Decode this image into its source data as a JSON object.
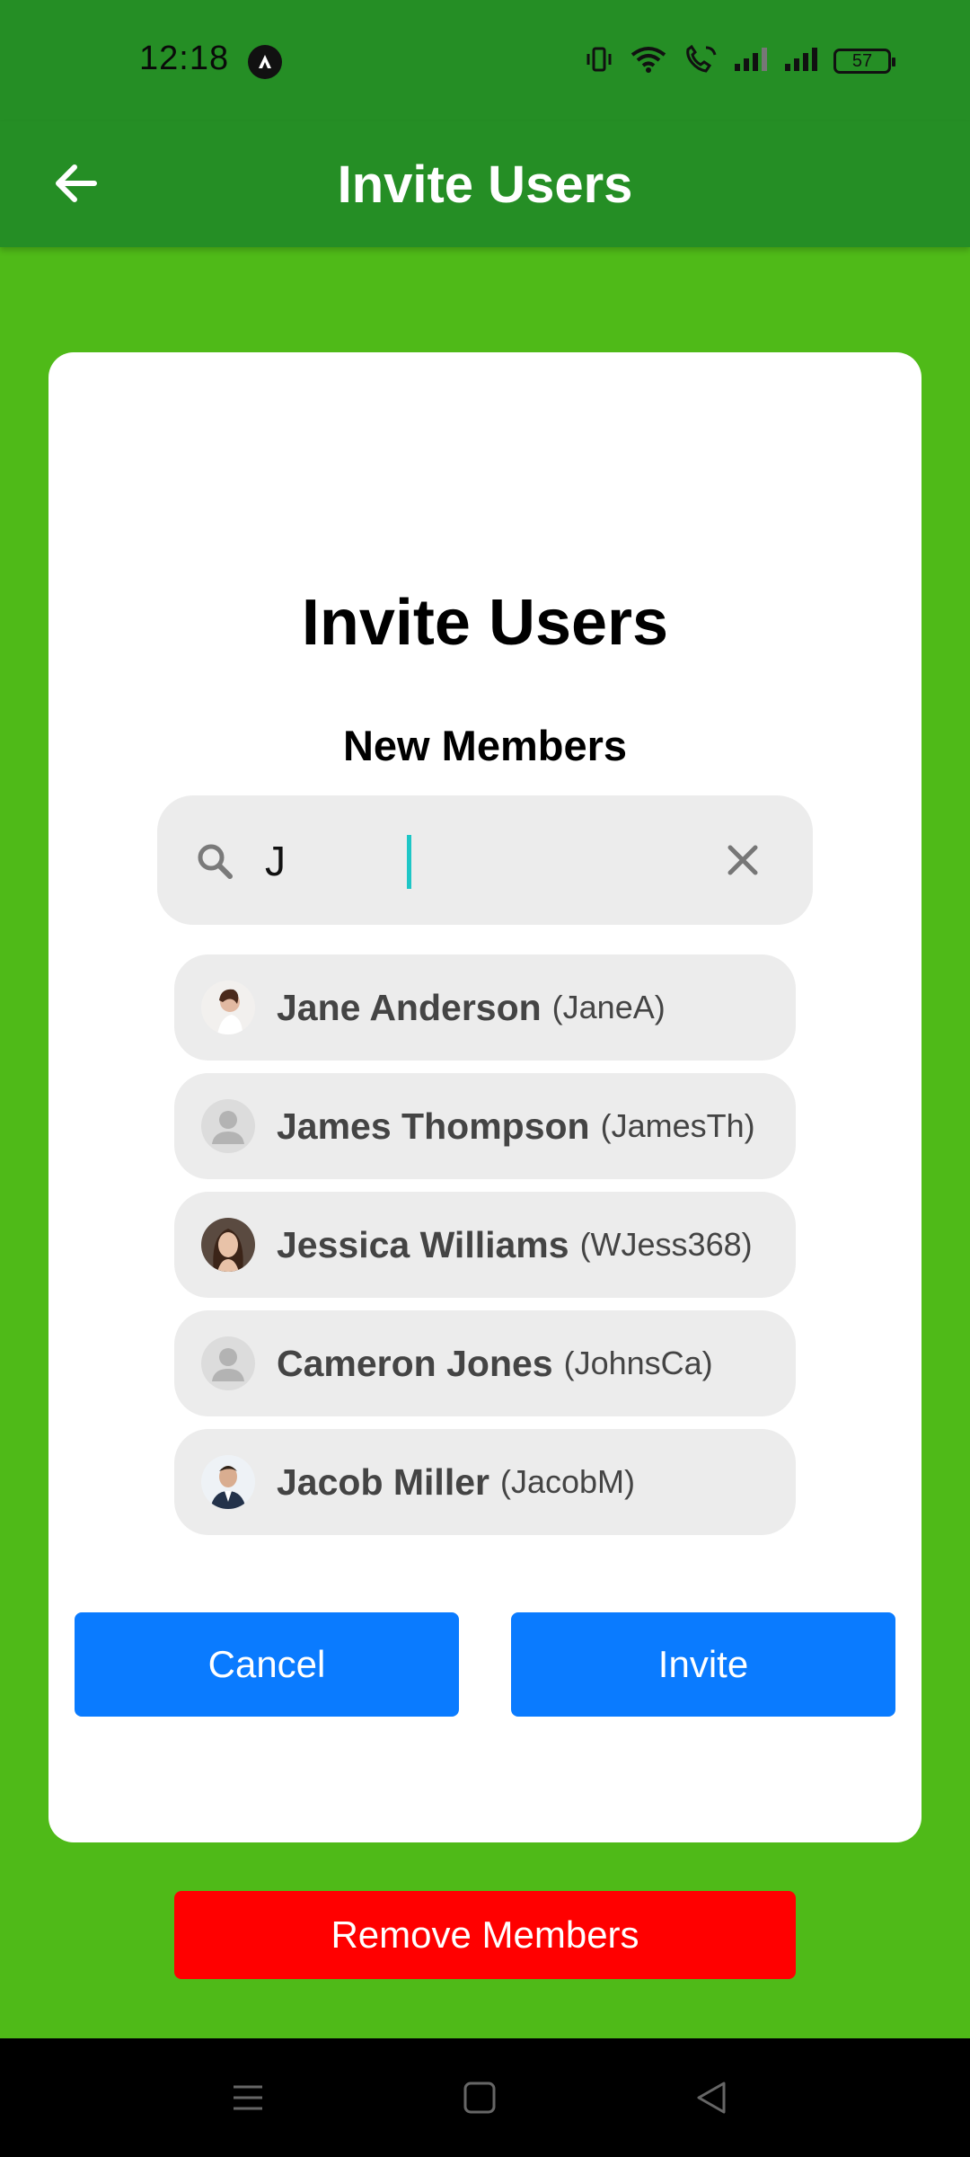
{
  "status_bar": {
    "time": "12:18",
    "battery": "57"
  },
  "app_bar": {
    "title": "Invite Users"
  },
  "dialog": {
    "title": "Invite Users",
    "subtitle": "New Members",
    "search": {
      "value": "J"
    },
    "results": [
      {
        "name": "Jane Anderson",
        "handle": "(JaneA)",
        "avatar": "photo"
      },
      {
        "name": "James Thompson",
        "handle": "(JamesTh)",
        "avatar": "placeholder"
      },
      {
        "name": "Jessica Williams",
        "handle": "(WJess368)",
        "avatar": "photo"
      },
      {
        "name": "Cameron Jones",
        "handle": "(JohnsCa)",
        "avatar": "placeholder"
      },
      {
        "name": "Jacob Miller",
        "handle": "(JacobM)",
        "avatar": "photo"
      }
    ],
    "cancel_label": "Cancel",
    "invite_label": "Invite"
  },
  "remove_members_label": "Remove Members",
  "colors": {
    "app_bar": "#258e25",
    "background": "#4fba18",
    "primary_button": "#0a7bff",
    "danger_button": "#ff0000"
  }
}
